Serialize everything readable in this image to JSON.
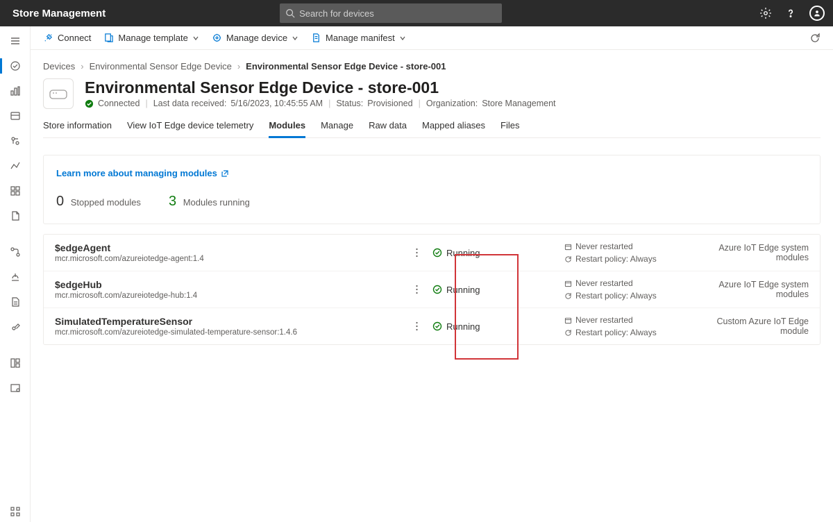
{
  "app": {
    "title": "Store Management"
  },
  "search": {
    "placeholder": "Search for devices"
  },
  "commands": {
    "connect": "Connect",
    "manage_template": "Manage template",
    "manage_device": "Manage device",
    "manage_manifest": "Manage manifest"
  },
  "breadcrumb": {
    "root": "Devices",
    "parent": "Environmental Sensor Edge Device",
    "current": "Environmental Sensor Edge Device - store-001"
  },
  "device": {
    "title": "Environmental Sensor Edge Device - store-001",
    "connected": "Connected",
    "last_data_label": "Last data received:",
    "last_data_value": "5/16/2023, 10:45:55 AM",
    "status_label": "Status:",
    "status_value": "Provisioned",
    "org_label": "Organization:",
    "org_value": "Store Management"
  },
  "tabs": [
    "Store information",
    "View IoT Edge device telemetry",
    "Modules",
    "Manage",
    "Raw data",
    "Mapped aliases",
    "Files"
  ],
  "active_tab": "Modules",
  "modules_panel": {
    "learn_more": "Learn more about managing modules",
    "stopped_count": "0",
    "stopped_label": "Stopped modules",
    "running_count": "3",
    "running_label": "Modules running"
  },
  "modules": [
    {
      "name": "$edgeAgent",
      "image": "mcr.microsoft.com/azureiotedge-agent:1.4",
      "status": "Running",
      "restart_count": "Never restarted",
      "restart_policy": "Restart policy: Always",
      "type": "Azure IoT Edge system modules"
    },
    {
      "name": "$edgeHub",
      "image": "mcr.microsoft.com/azureiotedge-hub:1.4",
      "status": "Running",
      "restart_count": "Never restarted",
      "restart_policy": "Restart policy: Always",
      "type": "Azure IoT Edge system modules"
    },
    {
      "name": "SimulatedTemperatureSensor",
      "image": "mcr.microsoft.com/azureiotedge-simulated-temperature-sensor:1.4.6",
      "status": "Running",
      "restart_count": "Never restarted",
      "restart_policy": "Restart policy: Always",
      "type": "Custom Azure IoT Edge module"
    }
  ]
}
